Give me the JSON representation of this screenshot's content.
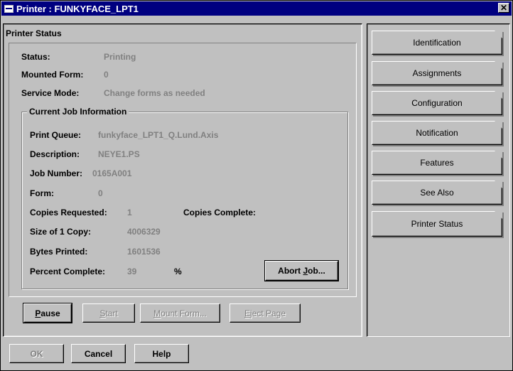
{
  "window": {
    "title": "Printer : FUNKYFACE_LPT1",
    "close_label": "✕"
  },
  "panel": {
    "title": "Printer Status"
  },
  "status": {
    "status_label": "Status:",
    "status_value": "Printing",
    "mounted_form_label": "Mounted Form:",
    "mounted_form_value": "0",
    "service_mode_label": "Service Mode:",
    "service_mode_value": "Change forms as needed"
  },
  "job": {
    "group_title": "Current Job Information",
    "print_queue_label": "Print Queue:",
    "print_queue_value": "funkyface_LPT1_Q.Lund.Axis",
    "description_label": "Description:",
    "description_value": "NEYE1.PS",
    "job_number_label": "Job Number:",
    "job_number_value": "0165A001",
    "form_label": "Form:",
    "form_value": "0",
    "copies_requested_label": "Copies Requested:",
    "copies_requested_value": "1",
    "copies_complete_label": "Copies Complete:",
    "size_label": "Size of 1 Copy:",
    "size_value": "4006329",
    "bytes_printed_label": "Bytes Printed:",
    "bytes_printed_value": "1601536",
    "percent_label": "Percent Complete:",
    "percent_value": "39",
    "percent_unit": "%",
    "abort_pre": "Abort ",
    "abort_ul": "J",
    "abort_post": "ob..."
  },
  "actions": {
    "pause_ul": "P",
    "pause_rest": "ause",
    "start_ul": "S",
    "start_rest": "tart",
    "mount_ul": "M",
    "mount_rest": "ount Form...",
    "eject_ul": "E",
    "eject_rest": "ject Page"
  },
  "tabs": [
    {
      "label": "Identification"
    },
    {
      "label": "Assignments"
    },
    {
      "label": "Configuration"
    },
    {
      "label": "Notification"
    },
    {
      "label": "Features"
    },
    {
      "label": "See Also"
    },
    {
      "label": "Printer Status"
    }
  ],
  "footer": {
    "ok_label": "OK",
    "cancel_label": "Cancel",
    "help_label": "Help"
  }
}
